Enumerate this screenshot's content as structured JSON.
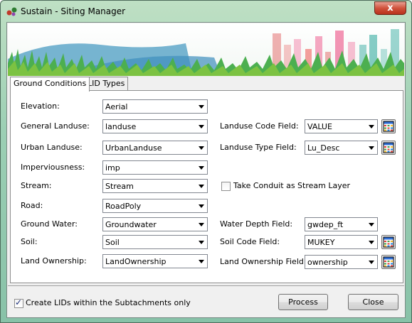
{
  "window": {
    "title": "Sustain - Siting Manager",
    "close_glyph": "x"
  },
  "tabs": [
    {
      "label": "Ground Conditions",
      "active": true
    },
    {
      "label": "LID Types",
      "active": false
    }
  ],
  "left_fields": [
    {
      "label": "Elevation:",
      "value": "Aerial"
    },
    {
      "label": "General Landuse:",
      "value": "landuse"
    },
    {
      "label": "Urban Landuse:",
      "value": "UrbanLanduse"
    },
    {
      "label": "Imperviousness:",
      "value": "imp"
    },
    {
      "label": "Stream:",
      "value": "Stream"
    },
    {
      "label": "Road:",
      "value": "RoadPoly"
    },
    {
      "label": "Ground Water:",
      "value": "Groundwater"
    },
    {
      "label": "Soil:",
      "value": "Soil"
    },
    {
      "label": "Land Ownership:",
      "value": "LandOwnership"
    }
  ],
  "right_fields": {
    "landuse_code": {
      "label": "Landuse Code Field:",
      "value": "VALUE"
    },
    "landuse_type": {
      "label": "Landuse Type Field:",
      "value": "Lu_Desc"
    },
    "water_depth": {
      "label": "Water Depth Field:",
      "value": "gwdep_ft"
    },
    "soil_code": {
      "label": "Soil Code Field:",
      "value": "MUKEY"
    },
    "land_ownership": {
      "label": "Land Ownership Field:",
      "value": "ownership"
    }
  },
  "stream_option": {
    "label": "Take Conduit as Stream Layer",
    "checked": false
  },
  "footer": {
    "subcatchments_option": {
      "label": "Create LIDs within the Subtachments only",
      "checked": true
    },
    "process_label": "Process",
    "close_label": "Close"
  },
  "icons": {
    "app": "sustain-app-icon",
    "table": "table-grid-icon",
    "dropdown": "chevron-down-icon"
  }
}
